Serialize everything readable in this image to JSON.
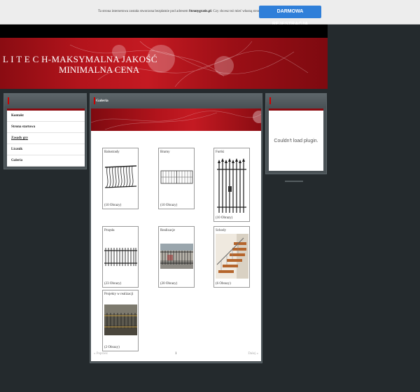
{
  "promo": {
    "text_before": "Ta strona internetowa została stworzona bezpłatnie pod adresem ",
    "domain": "Stronygratis.pl",
    "text_after": ". Czy chcesz też mieć własną stronę?",
    "button": "DARMOWA REJESTRACJA"
  },
  "header": {
    "line1": "L I T E C H-MAKSYMALNA JAKOŚĆ",
    "line2": "MINIMALNA CENA"
  },
  "menu": {
    "items": [
      "Kontakt",
      "Strona startowa",
      "Zasady gry",
      "Licznik",
      "Galeria"
    ]
  },
  "gallery": {
    "title": "Galeria",
    "items": [
      {
        "name": "Balustrady",
        "count": "(10 Obrazy)"
      },
      {
        "name": "Bramy",
        "count": "(10 Obrazy)"
      },
      {
        "name": "Furtki",
        "count": "(10 Obrazy)"
      },
      {
        "name": "Przęsła",
        "count": "(23 Obrazy)"
      },
      {
        "name": "Realizacje",
        "count": "(20 Obrazy)"
      },
      {
        "name": "Schody",
        "count": "(6 Obrazy)"
      },
      {
        "name": "Projekty w realizacji",
        "count": "(2 Obrazy)"
      }
    ],
    "pager": {
      "prev": "« Poprzez",
      "page": "1",
      "next": "Dalej »"
    }
  },
  "plugin": {
    "message": "Couldn't load plugin."
  },
  "icons": {
    "panel_marker": "red-bar-icon"
  },
  "colors": {
    "accent": "#2f7fd9",
    "brand_red": "#b3141c",
    "background": "#242a2d"
  }
}
